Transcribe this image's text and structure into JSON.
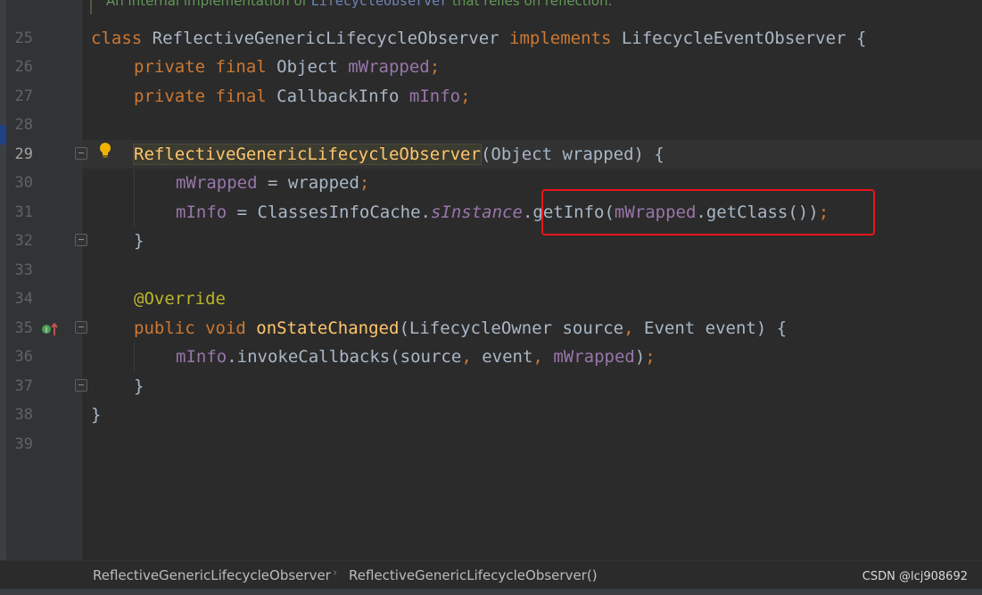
{
  "doc_comment": {
    "prefix": "An internal implementation of ",
    "code_ref": "LifecycleObserver",
    "suffix": " that relies on reflection."
  },
  "line_numbers": [
    "25",
    "26",
    "27",
    "28",
    "29",
    "30",
    "31",
    "32",
    "33",
    "34",
    "35",
    "36",
    "37",
    "38",
    "39"
  ],
  "current_line": "29",
  "code": {
    "l25": {
      "kw_class": "class",
      "class_name": " ReflectiveGenericLifecycleObserver ",
      "kw_implements": "implements",
      "rest": " LifecycleEventObserver {"
    },
    "l26": {
      "kw": "private final",
      "type": " Object ",
      "field": "mWrapped",
      "semi": ";"
    },
    "l27": {
      "kw": "private final",
      "type": " CallbackInfo ",
      "field": "mInfo",
      "semi": ";"
    },
    "l29": {
      "ctor": "ReflectiveGenericLifecycleObserver",
      "rest": "(Object wrapped) {"
    },
    "l30": {
      "field": "mWrapped",
      "rest": " = wrapped",
      "semi": ";"
    },
    "l31": {
      "field": "mInfo",
      "mid": " = ClassesInfoCache.",
      "static_field": "sInstance",
      "call": ".getInfo(",
      "field2": "mWrapped",
      "end": ".getClass())",
      "semi": ";"
    },
    "l32": {
      "text": "}"
    },
    "l34": {
      "annotation": "@Override"
    },
    "l35": {
      "kw": "public void ",
      "method": "onStateChanged",
      "p1": "(LifecycleOwner source",
      "comma": ",",
      "p2": " Event event) {"
    },
    "l36": {
      "field": "mInfo",
      "call": ".invokeCallbacks(source",
      "c1": ",",
      "a2": " event",
      "c2": ",",
      "sp": " ",
      "field2": "mWrapped",
      "close": ")",
      "semi": ";"
    },
    "l37": {
      "text": "}"
    },
    "l38": {
      "text": "}"
    }
  },
  "breadcrumb": {
    "items": [
      "ReflectiveGenericLifecycleObserver",
      "ReflectiveGenericLifecycleObserver()"
    ],
    "separator": "›"
  },
  "watermark": "CSDN @lcj908692",
  "icons": [
    "intention-bulb-icon",
    "override-implements-icon",
    "fold-icon"
  ],
  "colors": {
    "background": "#2b2b2b",
    "keyword": "#cc7832",
    "field": "#9876aa",
    "method": "#ffc66d",
    "annotation": "#bbb529",
    "highlight_box": "#e8151b"
  }
}
